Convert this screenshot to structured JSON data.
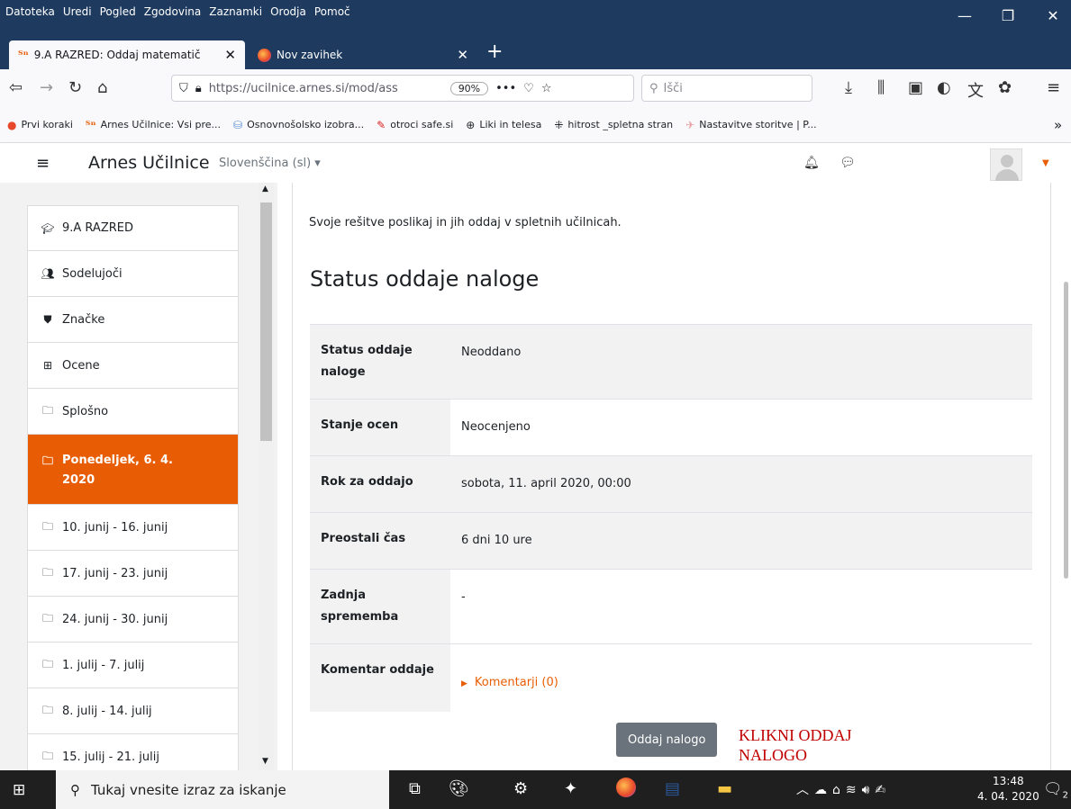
{
  "browser": {
    "menu": [
      "Datoteka",
      "Uredi",
      "Pogled",
      "Zgodovina",
      "Zaznamki",
      "Orodja",
      "Pomoč"
    ],
    "window_controls": {
      "minimize": "—",
      "restore": "❐",
      "close": "✕"
    },
    "tabs": [
      {
        "label": "9.A RAZRED: Oddaj matematič",
        "icon": "arnes-logo",
        "active": true
      },
      {
        "label": "Nov zavihek",
        "icon": "firefox-logo",
        "active": false
      }
    ],
    "url": "https://ucilnice.arnes.si/mod/ass",
    "zoom": "90%",
    "search_placeholder": "Išči",
    "bookmarks": [
      {
        "label": "Prvi koraki",
        "icon": "firefox-icon"
      },
      {
        "label": "Arnes Učilnice: Vsi pre...",
        "icon": "arnes-icon"
      },
      {
        "label": "Osnovnošolsko izobra...",
        "icon": "bucket-icon"
      },
      {
        "label": "otroci safe.si",
        "icon": "pen-icon"
      },
      {
        "label": "Liki in telesa",
        "icon": "globe-icon"
      },
      {
        "label": "hitrost _spletna stran",
        "icon": "dots-icon"
      },
      {
        "label": "Nastavitve storitve | P...",
        "icon": "plane-icon"
      }
    ],
    "overflow": "»"
  },
  "moodle": {
    "site_name": "Arnes Učilnice",
    "language": "Slovenščina (sl) ▾",
    "drawer": [
      {
        "label": "9.A RAZRED",
        "icon": "graduation-cap-icon"
      },
      {
        "label": "Sodelujoči",
        "icon": "users-icon"
      },
      {
        "label": "Značke",
        "icon": "shield-icon"
      },
      {
        "label": "Ocene",
        "icon": "table-icon"
      },
      {
        "label": "Splošno",
        "icon": "folder-icon"
      },
      {
        "label": "Ponedeljek, 6. 4. 2020",
        "icon": "folder-icon",
        "active": true
      },
      {
        "label": "10. junij - 16. junij",
        "icon": "folder-icon"
      },
      {
        "label": "17. junij - 23. junij",
        "icon": "folder-icon"
      },
      {
        "label": "24. junij - 30. junij",
        "icon": "folder-icon"
      },
      {
        "label": "1. julij - 7. julij",
        "icon": "folder-icon"
      },
      {
        "label": "8. julij - 14. julij",
        "icon": "folder-icon"
      },
      {
        "label": "15. julij - 21. julij",
        "icon": "folder-icon"
      }
    ],
    "intro_text": "Svoje rešitve poslikaj in jih oddaj v spletnih učilnicah.",
    "status_heading": "Status oddaje naloge",
    "status_rows": [
      {
        "label": "Status oddaje naloge",
        "value": "Neoddano",
        "grey": true
      },
      {
        "label": "Stanje ocen",
        "value": "Neocenjeno",
        "grey": false
      },
      {
        "label": "Rok za oddajo",
        "value": "sobota, 11. april 2020, 00:00",
        "grey": true
      },
      {
        "label": "Preostali čas",
        "value": "6 dni 10 ure",
        "grey": true
      },
      {
        "label": "Zadnja sprememba",
        "value": "-",
        "grey": false
      },
      {
        "label": "Komentar oddaje",
        "value": "Komentarji (0)",
        "grey": false,
        "link": true
      }
    ],
    "submit_button": "Oddaj nalogo",
    "annotation": "KLIKNI ODDAJ NALOGO"
  },
  "taskbar": {
    "search_placeholder": "Tukaj vnesite izraz za iskanje",
    "time": "13:48",
    "date": "4. 04. 2020",
    "notification_count": "2"
  }
}
